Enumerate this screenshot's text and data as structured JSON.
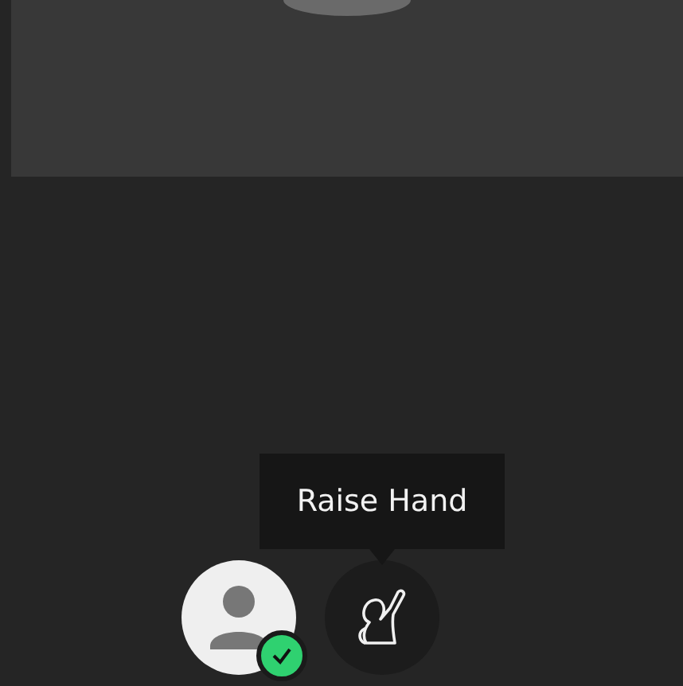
{
  "user": {
    "verified": true
  },
  "controls": [
    {
      "kind": "raise_hand",
      "tooltip": "Raise Hand"
    }
  ]
}
